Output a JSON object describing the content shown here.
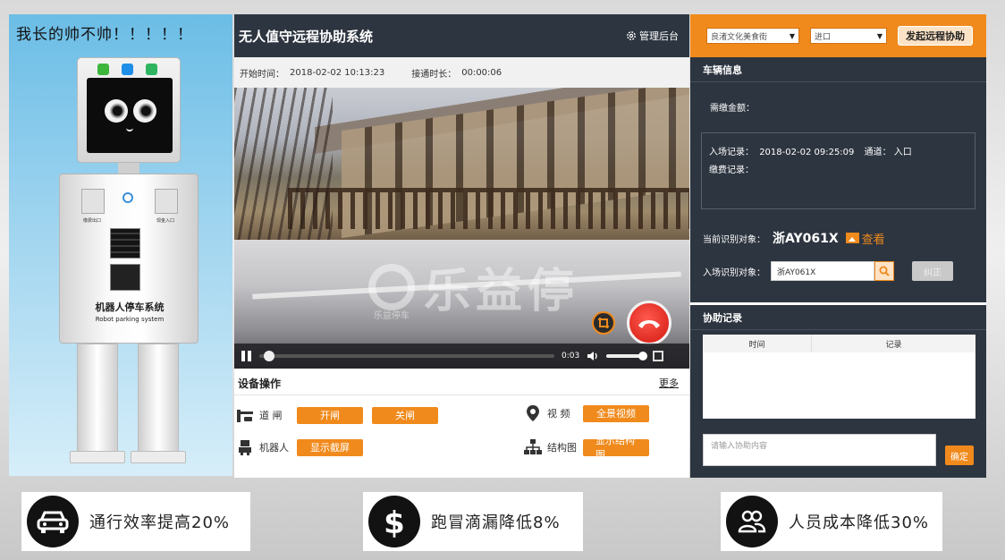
{
  "robot": {
    "caption": "我长的帅不帅！！！！！",
    "title_cn": "机器人停车系统",
    "title_en": "Robot parking system",
    "slot_left_label": "缴费出口",
    "slot_right_label": "现金入口"
  },
  "app": {
    "title": "无人值守远程协助系统",
    "admin_link": "管理后台",
    "start_time_label": "开始时间：",
    "start_time_value": "2018-02-02 10:13:23",
    "duration_label": "接通时长：",
    "duration_value": "00:00:06"
  },
  "video": {
    "watermark": "乐益停",
    "watermark_sub": "乐益停车",
    "time": "0:03",
    "progress": 0.02
  },
  "operations": {
    "title": "设备操作",
    "more": "更多",
    "rows": {
      "gate": {
        "label": "道 闸",
        "buttons": [
          "开闸",
          "关闸"
        ]
      },
      "robot": {
        "label": "机器人",
        "buttons": [
          "显示截屏"
        ]
      },
      "video": {
        "label": "视 频",
        "buttons": [
          "全景视频"
        ]
      },
      "structure": {
        "label": "结构图",
        "buttons": [
          "显示结构图"
        ]
      }
    }
  },
  "right": {
    "site_select": "良渚文化美食街",
    "direction_select": "进口",
    "start_assist": "发起远程协助",
    "vehicle_title": "车辆信息",
    "fee_label": "需缴金额：",
    "entry_record_label": "入场记录：",
    "entry_record_time": "2018-02-02 09:25:09",
    "entry_channel_label": "通道：",
    "entry_channel_value": "入口",
    "payment_label": "缴费记录：",
    "current_label": "当前识别对象：",
    "current_plate": "浙AY061X",
    "view_label": "查看",
    "entry_recog_label": "入场识别对象：",
    "entry_recog_value": "浙AY061X",
    "fix_button": "纠正",
    "assist_title": "协助记录",
    "col_time": "时间",
    "col_record": "记录",
    "assist_placeholder": "请输入协助内容",
    "ok_button": "确定"
  },
  "stats": [
    {
      "icon": "car-icon",
      "text": "通行效率提高20%"
    },
    {
      "icon": "dollar-icon",
      "text": "跑冒滴漏降低8%"
    },
    {
      "icon": "people-icon",
      "text": "人员成本降低30%"
    }
  ],
  "colors": {
    "accent": "#f08a1c",
    "dark_panel": "#2d3540",
    "hangup": "#d2180f"
  }
}
